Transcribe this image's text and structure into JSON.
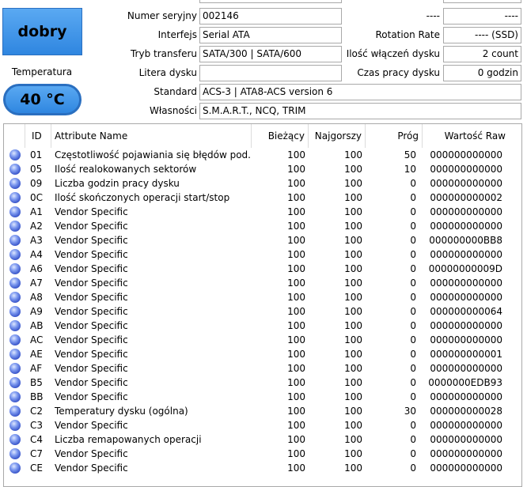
{
  "health": {
    "status": "dobry"
  },
  "temperature": {
    "label": "Temperatura",
    "value": "40 °C"
  },
  "info_left": [
    {
      "label": "Numer seryjny",
      "value": "002146"
    },
    {
      "label": "Interfejs",
      "value": "Serial ATA"
    },
    {
      "label": "Tryb transferu",
      "value": "SATA/300 | SATA/600"
    },
    {
      "label": "Litera dysku",
      "value": ""
    },
    {
      "label": "Standard",
      "value": "ACS-3 | ATA8-ACS version 6"
    },
    {
      "label": "Własności",
      "value": "S.M.A.R.T., NCQ, TRIM"
    }
  ],
  "info_right": [
    {
      "label": "----",
      "value": "----"
    },
    {
      "label": "Rotation Rate",
      "value": "---- (SSD)"
    },
    {
      "label": "Ilość włączeń dysku",
      "value": "2 count"
    },
    {
      "label": "Czas pracy dysku",
      "value": "0 godzin"
    }
  ],
  "table": {
    "headers": [
      "ID",
      "Attribute Name",
      "Bieżący",
      "Najgorszy",
      "Próg",
      "Wartość Raw"
    ],
    "rows": [
      [
        "01",
        "Częstotliwość pojawiania się błędów pod...",
        "100",
        "100",
        "50",
        "000000000000"
      ],
      [
        "05",
        "Ilość realokowanych sektorów",
        "100",
        "100",
        "10",
        "000000000000"
      ],
      [
        "09",
        "Liczba godzin pracy dysku",
        "100",
        "100",
        "0",
        "000000000000"
      ],
      [
        "0C",
        "Ilość skończonych operacji start/stop",
        "100",
        "100",
        "0",
        "000000000002"
      ],
      [
        "A1",
        "Vendor Specific",
        "100",
        "100",
        "0",
        "000000000000"
      ],
      [
        "A2",
        "Vendor Specific",
        "100",
        "100",
        "0",
        "000000000000"
      ],
      [
        "A3",
        "Vendor Specific",
        "100",
        "100",
        "0",
        "000000000BB8"
      ],
      [
        "A4",
        "Vendor Specific",
        "100",
        "100",
        "0",
        "000000000000"
      ],
      [
        "A6",
        "Vendor Specific",
        "100",
        "100",
        "0",
        "00000000009D"
      ],
      [
        "A7",
        "Vendor Specific",
        "100",
        "100",
        "0",
        "000000000000"
      ],
      [
        "A8",
        "Vendor Specific",
        "100",
        "100",
        "0",
        "000000000000"
      ],
      [
        "A9",
        "Vendor Specific",
        "100",
        "100",
        "0",
        "000000000064"
      ],
      [
        "AB",
        "Vendor Specific",
        "100",
        "100",
        "0",
        "000000000000"
      ],
      [
        "AC",
        "Vendor Specific",
        "100",
        "100",
        "0",
        "000000000000"
      ],
      [
        "AE",
        "Vendor Specific",
        "100",
        "100",
        "0",
        "000000000001"
      ],
      [
        "AF",
        "Vendor Specific",
        "100",
        "100",
        "0",
        "000000000000"
      ],
      [
        "B5",
        "Vendor Specific",
        "100",
        "100",
        "0",
        "0000000EDB93"
      ],
      [
        "BB",
        "Vendor Specific",
        "100",
        "100",
        "0",
        "000000000000"
      ],
      [
        "C2",
        "Temperatury dysku (ogólna)",
        "100",
        "100",
        "30",
        "000000000028"
      ],
      [
        "C3",
        "Vendor Specific",
        "100",
        "100",
        "0",
        "000000000000"
      ],
      [
        "C4",
        "Liczba remapowanych operacji",
        "100",
        "100",
        "0",
        "000000000000"
      ],
      [
        "C7",
        "Vendor Specific",
        "100",
        "100",
        "0",
        "000000000000"
      ],
      [
        "CE",
        "Vendor Specific",
        "100",
        "100",
        "0",
        "000000000000"
      ]
    ]
  },
  "colors": {
    "status_blue": "#3b8fe6",
    "row_dot": "#3652c8",
    "border": "#a9a9a9"
  }
}
